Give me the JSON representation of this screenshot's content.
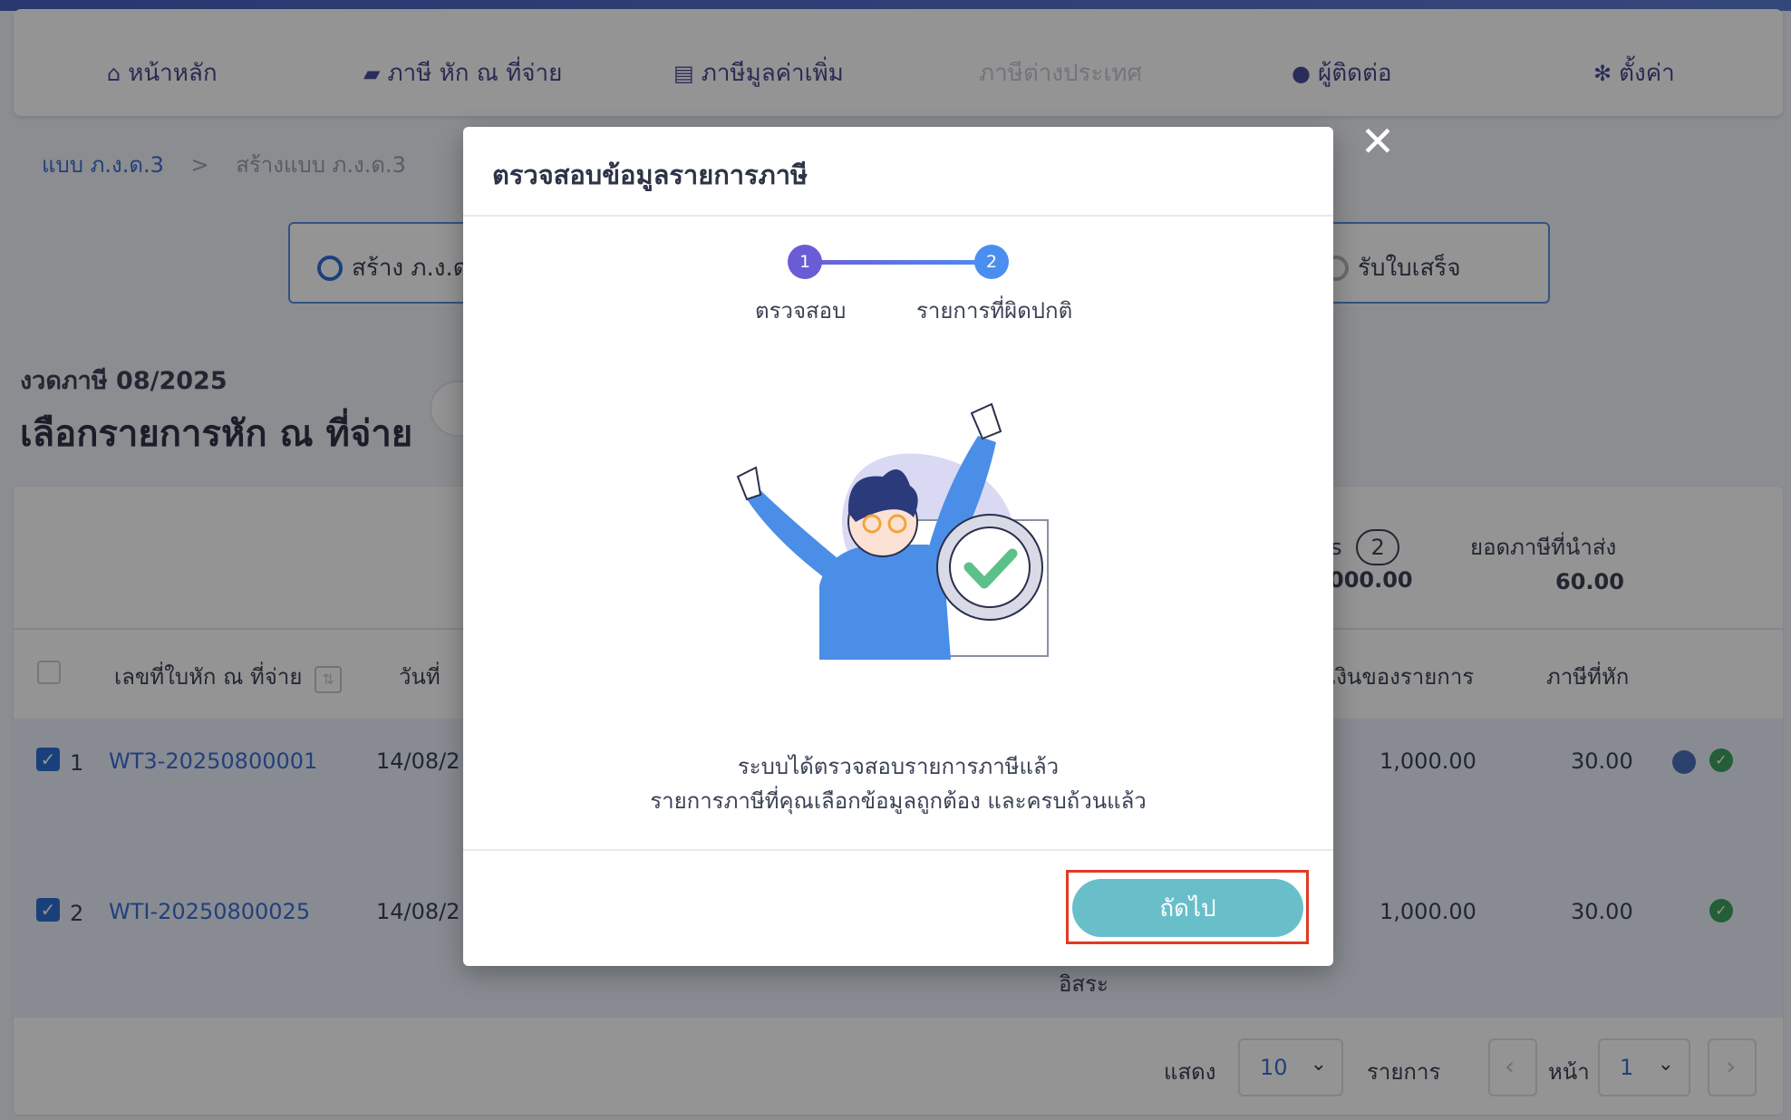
{
  "nav": {
    "home": "หน้าหลัก",
    "wht": "ภาษี หัก ณ ที่จ่าย",
    "vat": "ภาษีมูลค่าเพิ่ม",
    "foreign": "ภาษีต่างประเทศ",
    "contacts": "ผู้ติดต่อ",
    "settings": "ตั้งค่า"
  },
  "breadcrumb": {
    "root": "แบบ ภ.ง.ด.3",
    "sep": ">",
    "current": "สร้างแบบ ภ.ง.ด.3"
  },
  "steps_bar": {
    "first": "สร้าง ภ.ง.ด",
    "last": "รับใบเสร็จ"
  },
  "page": {
    "period": "งวดภาษี 08/2025",
    "title": "เลือกรายการหัก ณ ที่จ่าย"
  },
  "summary": {
    "count_suffix": "s",
    "count": "2",
    "amount_partial": "000.00",
    "tax_label": "ยอดภาษีที่นำส่ง",
    "tax_value": "60.00"
  },
  "table": {
    "headers": {
      "doc_no": "เลขที่ใบหัก ณ ที่จ่าย",
      "date": "วันที่",
      "amount": "เงินของรายการ",
      "tax": "ภาษีที่หัก"
    },
    "rows": [
      {
        "index": "1",
        "doc_no": "WT3-20250800001",
        "date": "14/08/2",
        "amount": "1,000.00",
        "tax": "30.00"
      },
      {
        "index": "2",
        "doc_no": "WTI-20250800025",
        "date": "14/08/2",
        "amount": "1,000.00",
        "tax": "30.00",
        "extra": "อิสระ"
      }
    ]
  },
  "pager": {
    "show": "แสดง",
    "size": "10",
    "items": "รายการ",
    "page_label": "หน้า",
    "page": "1"
  },
  "modal": {
    "title": "ตรวจสอบข้อมูลรายการภาษี",
    "step1_num": "1",
    "step1_label": "ตรวจสอบ",
    "step2_num": "2",
    "step2_label": "รายการที่ผิดปกติ",
    "msg_line1": "ระบบได้ตรวจสอบรายการภาษีแล้ว",
    "msg_line2": "รายการภาษีที่คุณเลือกข้อมูลถูกต้อง และครบถ้วนแล้ว",
    "next": "ถัดไป"
  },
  "colors": {
    "accent": "#2d6ed6",
    "next_button": "#68bfca",
    "highlight": "#e03a25"
  }
}
